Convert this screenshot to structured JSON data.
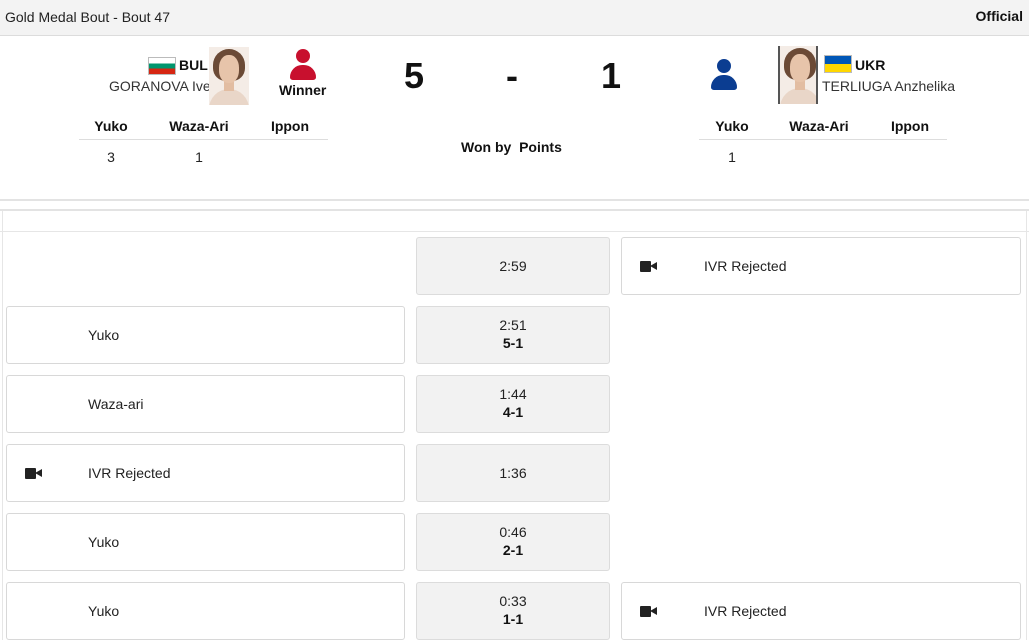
{
  "topbar": {
    "title": "Gold Medal Bout - Bout 47",
    "status": "Official"
  },
  "athlete_left": {
    "noc": "BUL",
    "name": "GORANOVA Ivet",
    "winner_label": "Winner"
  },
  "athlete_right": {
    "noc": "UKR",
    "name": "TERLIUGA Anzhelika"
  },
  "score": {
    "left": "5",
    "separator": "-",
    "right": "1"
  },
  "result": {
    "won_by": "Won by",
    "method": "Points"
  },
  "score_table": {
    "headers": [
      "Yuko",
      "Waza-Ari",
      "Ippon"
    ],
    "left_values": [
      "3",
      "1",
      ""
    ],
    "right_values": [
      "1",
      "",
      ""
    ]
  },
  "timeline": [
    {
      "time": "2:59",
      "score": "",
      "left_action": "",
      "left_icon": "",
      "right_action": "IVR Rejected",
      "right_icon": "video-camera"
    },
    {
      "time": "2:51",
      "score": "5-1",
      "left_action": "Yuko",
      "left_icon": "",
      "right_action": "",
      "right_icon": ""
    },
    {
      "time": "1:44",
      "score": "4-1",
      "left_action": "Waza-ari",
      "left_icon": "",
      "right_action": "",
      "right_icon": ""
    },
    {
      "time": "1:36",
      "score": "",
      "left_action": "IVR Rejected",
      "left_icon": "video-camera",
      "right_action": "",
      "right_icon": ""
    },
    {
      "time": "0:46",
      "score": "2-1",
      "left_action": "Yuko",
      "left_icon": "",
      "right_action": "",
      "right_icon": ""
    },
    {
      "time": "0:33",
      "score": "1-1",
      "left_action": "Yuko",
      "left_icon": "",
      "right_action": "IVR Rejected",
      "right_icon": "video-camera"
    }
  ],
  "colors": {
    "red_athlete": "#c8102e",
    "blue_athlete": "#0b3d91",
    "mid_bg": "#f2f2f2"
  }
}
